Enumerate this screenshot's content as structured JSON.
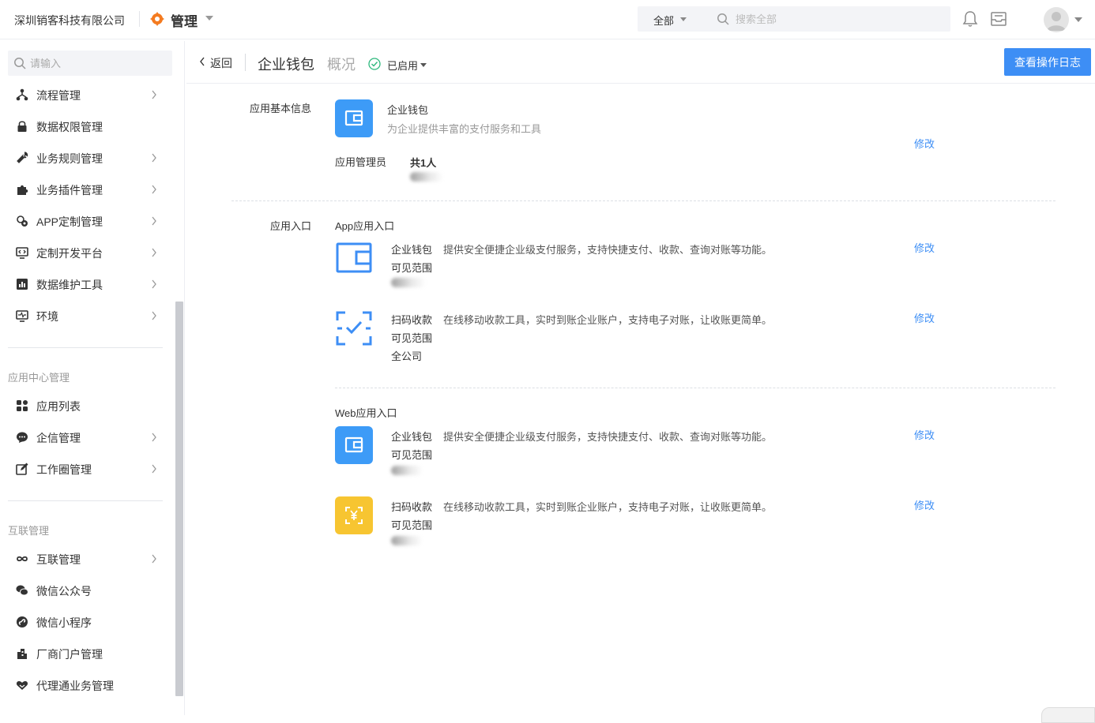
{
  "topbar": {
    "company": "深圳销客科技有限公司",
    "brand_title": "管理",
    "scope": "全部",
    "search_placeholder": "搜索全部"
  },
  "sidebar": {
    "search_placeholder": "请输入",
    "items": [
      {
        "label": "流程管理",
        "icon": "flow-icon",
        "arrow": true
      },
      {
        "label": "数据权限管理",
        "icon": "lock-icon",
        "arrow": false
      },
      {
        "label": "业务规则管理",
        "icon": "wrench-icon",
        "arrow": true
      },
      {
        "label": "业务插件管理",
        "icon": "puzzle-icon",
        "arrow": true
      },
      {
        "label": "APP定制管理",
        "icon": "app-custom-icon",
        "arrow": true
      },
      {
        "label": "定制开发平台",
        "icon": "dev-platform-icon",
        "arrow": true
      },
      {
        "label": "数据维护工具",
        "icon": "chart-tool-icon",
        "arrow": true
      },
      {
        "label": "环境",
        "icon": "pulse-monitor-icon",
        "arrow": true
      }
    ],
    "group_app_center": {
      "title": "应用中心管理",
      "items": [
        {
          "label": "应用列表",
          "icon": "grid-icon",
          "arrow": false
        },
        {
          "label": "企信管理",
          "icon": "chat-bubble-icon",
          "arrow": true
        },
        {
          "label": "工作圈管理",
          "icon": "edit-square-icon",
          "arrow": true
        }
      ]
    },
    "group_interconnect": {
      "title": "互联管理",
      "items": [
        {
          "label": "互联管理",
          "icon": "infinity-icon",
          "arrow": true
        },
        {
          "label": "微信公众号",
          "icon": "wechat-icon",
          "arrow": false
        },
        {
          "label": "微信小程序",
          "icon": "mini-program-icon",
          "arrow": false
        },
        {
          "label": "厂商门户管理",
          "icon": "building-icon",
          "arrow": false
        },
        {
          "label": "代理通业务管理",
          "icon": "handshake-heart-icon",
          "arrow": false
        }
      ]
    }
  },
  "header": {
    "back": "返回",
    "app_name": "企业钱包",
    "overview": "概况",
    "status": "已启用",
    "log_button": "查看操作日志"
  },
  "basic_info": {
    "section_label": "应用基本信息",
    "app_name": "企业钱包",
    "app_desc": "为企业提供丰富的支付服务和工具",
    "admin_label": "应用管理员",
    "admin_count": "共1人",
    "edit": "修改"
  },
  "entry": {
    "section_label": "应用入口",
    "app_group": {
      "title": "App应用入口",
      "items": [
        {
          "name": "企业钱包",
          "desc": "提供安全便捷企业级支付服务，支持快捷支付、收款、查询对账等功能。",
          "visible_label": "可见范围",
          "visible_value": "",
          "edit": "修改"
        },
        {
          "name": "扫码收款",
          "desc": "在线移动收款工具，实时到账企业账户，支持电子对账，让收账更简单。",
          "visible_label": "可见范围",
          "visible_value": "全公司",
          "edit": "修改"
        }
      ]
    },
    "web_group": {
      "title": "Web应用入口",
      "items": [
        {
          "name": "企业钱包",
          "desc": "提供安全便捷企业级支付服务，支持快捷支付、收款、查询对账等功能。",
          "visible_label": "可见范围",
          "visible_value": "",
          "edit": "修改"
        },
        {
          "name": "扫码收款",
          "desc": "在线移动收款工具，实时到账企业账户，支持电子对账，让收账更简单。",
          "visible_label": "可见范围",
          "visible_value": "",
          "edit": "修改"
        }
      ]
    }
  },
  "colors": {
    "accent": "#3d8ef5",
    "brand_orange": "#f47b20",
    "tile_blue": "#3d9bf7",
    "tile_yellow": "#f7c531",
    "status_green": "#2db87d"
  }
}
